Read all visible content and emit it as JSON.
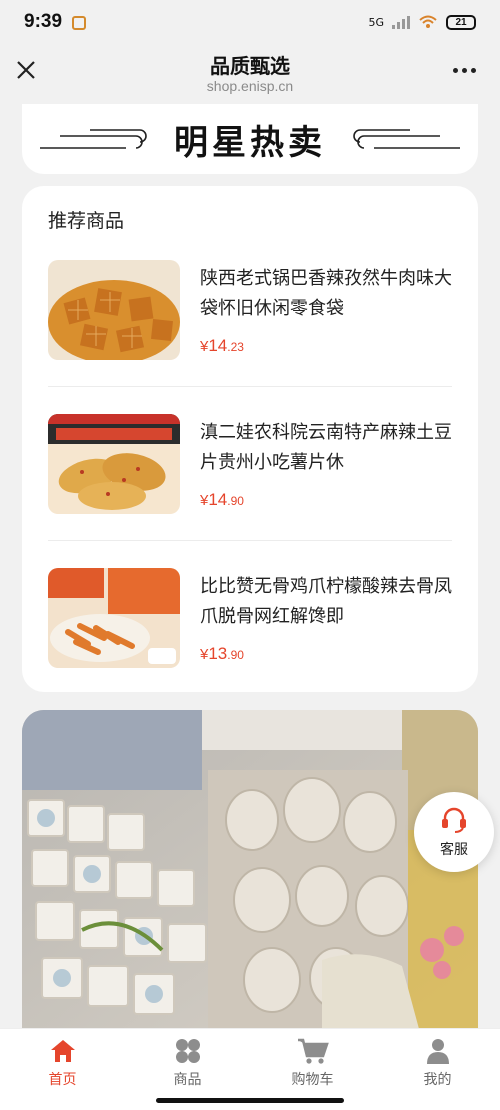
{
  "status_bar": {
    "time": "9:39",
    "network": "5G",
    "battery": "21"
  },
  "header": {
    "title": "品质甄选",
    "url": "shop.enisp.cn"
  },
  "banner": {
    "title": "明星热卖"
  },
  "recommended": {
    "heading": "推荐商品",
    "products": [
      {
        "name": "陕西老式锅巴香辣孜然牛肉味大袋怀旧休闲零食袋",
        "price_symbol": "¥",
        "price_int": "14",
        "price_dec": ".23"
      },
      {
        "name": "滇二娃农科院云南特产麻辣土豆片贵州小吃薯片休",
        "price_symbol": "¥",
        "price_int": "14",
        "price_dec": ".90"
      },
      {
        "name": "比比赞无骨鸡爪柠檬酸辣去骨凤爪脱骨网红解馋即",
        "price_symbol": "¥",
        "price_int": "13",
        "price_dec": ".90"
      }
    ]
  },
  "customer_service": {
    "label": "客服"
  },
  "tabbar": {
    "tabs": [
      {
        "label": "首页",
        "icon": "home-icon",
        "active": true
      },
      {
        "label": "商品",
        "icon": "grid-icon",
        "active": false
      },
      {
        "label": "购物车",
        "icon": "cart-icon",
        "active": false
      },
      {
        "label": "我的",
        "icon": "user-icon",
        "active": false
      }
    ]
  },
  "colors": {
    "accent": "#e5452c",
    "background": "#f1f1f1"
  }
}
